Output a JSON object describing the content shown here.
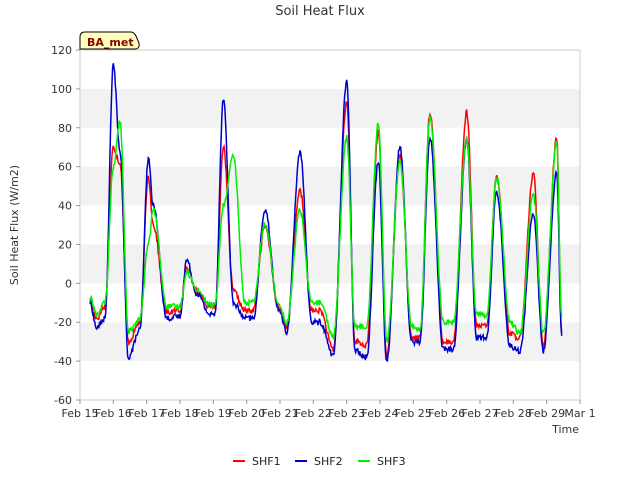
{
  "chart_data": {
    "type": "line",
    "title": "Soil Heat Flux",
    "xlabel": "Time",
    "ylabel": "Soil Heat Flux (W/m2)",
    "badge": "BA_met",
    "ylim": [
      -60,
      120
    ],
    "xlim": [
      0,
      15
    ],
    "yticks": [
      -60,
      -40,
      -20,
      0,
      20,
      40,
      60,
      80,
      100,
      120
    ],
    "xtick_labels": [
      "Feb 15",
      "Feb 16",
      "Feb 17",
      "Feb 18",
      "Feb 19",
      "Feb 20",
      "Feb 21",
      "Feb 22",
      "Feb 23",
      "Feb 24",
      "Feb 25",
      "Feb 26",
      "Feb 27",
      "Feb 28",
      "Feb 29",
      "Mar 1"
    ],
    "grid": "horizontal bands",
    "legend_position": "bottom",
    "colors": {
      "SHF1": "#ff0000",
      "SHF2": "#0000cc",
      "SHF3": "#00ee00",
      "band": "#f2f2f2"
    },
    "series": [
      {
        "name": "SHF1",
        "t": [
          0.3,
          0.5,
          0.75,
          1.0,
          1.2,
          1.45,
          1.8,
          2.05,
          2.2,
          2.6,
          3.0,
          3.2,
          3.5,
          3.9,
          4.05,
          4.3,
          4.6,
          4.95,
          5.2,
          5.55,
          5.95,
          6.2,
          6.6,
          6.95,
          7.2,
          7.6,
          8.0,
          8.25,
          8.6,
          8.95,
          9.2,
          9.6,
          9.95,
          10.2,
          10.5,
          10.9,
          11.2,
          11.6,
          11.9,
          12.2,
          12.5,
          12.9,
          13.2,
          13.6,
          13.9,
          14.3
        ],
        "v": [
          -8,
          -18,
          -12,
          70,
          62,
          -30,
          -20,
          55,
          30,
          -15,
          -14,
          8,
          -4,
          -12,
          -12,
          70,
          -4,
          -14,
          -14,
          30,
          -12,
          -22,
          48,
          -14,
          -14,
          -34,
          93,
          -30,
          -32,
          78,
          -38,
          65,
          -28,
          -28,
          88,
          -30,
          -30,
          88,
          -22,
          -22,
          55,
          -26,
          -28,
          56,
          -32,
          75
        ],
        "end": -25
      },
      {
        "name": "SHF2",
        "t": [
          0.3,
          0.5,
          0.75,
          1.0,
          1.2,
          1.45,
          1.8,
          2.05,
          2.2,
          2.6,
          3.0,
          3.2,
          3.5,
          3.9,
          4.05,
          4.3,
          4.6,
          4.95,
          5.2,
          5.55,
          5.95,
          6.2,
          6.6,
          6.95,
          7.2,
          7.6,
          8.0,
          8.25,
          8.6,
          8.95,
          9.2,
          9.6,
          9.95,
          10.2,
          10.5,
          10.9,
          11.2,
          11.6,
          11.9,
          12.2,
          12.5,
          12.9,
          13.2,
          13.6,
          13.9,
          14.3
        ],
        "v": [
          -10,
          -23,
          -18,
          112,
          68,
          -38,
          -24,
          64,
          40,
          -18,
          -17,
          12,
          -5,
          -16,
          -16,
          95,
          -10,
          -18,
          -18,
          38,
          -13,
          -25,
          67,
          -20,
          -20,
          -37,
          104,
          -34,
          -38,
          63,
          -40,
          70,
          -30,
          -30,
          75,
          -34,
          -34,
          74,
          -28,
          -28,
          47,
          -32,
          -35,
          36,
          -35,
          57
        ],
        "end": -27
      },
      {
        "name": "SHF3",
        "t": [
          0.3,
          0.5,
          0.75,
          1.0,
          1.2,
          1.45,
          1.8,
          2.05,
          2.2,
          2.6,
          3.0,
          3.2,
          3.5,
          3.9,
          4.05,
          4.3,
          4.6,
          4.95,
          5.2,
          5.55,
          5.95,
          6.2,
          6.6,
          6.95,
          7.2,
          7.6,
          8.0,
          8.25,
          8.6,
          8.95,
          9.2,
          9.6,
          9.95,
          10.2,
          10.5,
          10.9,
          11.2,
          11.6,
          11.9,
          12.2,
          12.5,
          12.9,
          13.2,
          13.6,
          13.9,
          14.3
        ],
        "v": [
          -7,
          -16,
          -10,
          60,
          83,
          -25,
          -18,
          20,
          38,
          -12,
          -12,
          6,
          -3,
          -11,
          -11,
          40,
          65,
          -10,
          -10,
          31,
          -10,
          -20,
          38,
          -10,
          -10,
          -27,
          75,
          -22,
          -22,
          82,
          -30,
          63,
          -22,
          -24,
          86,
          -20,
          -20,
          75,
          -16,
          -16,
          54,
          -20,
          -26,
          46,
          -26,
          72
        ],
        "end": -17
      }
    ]
  }
}
